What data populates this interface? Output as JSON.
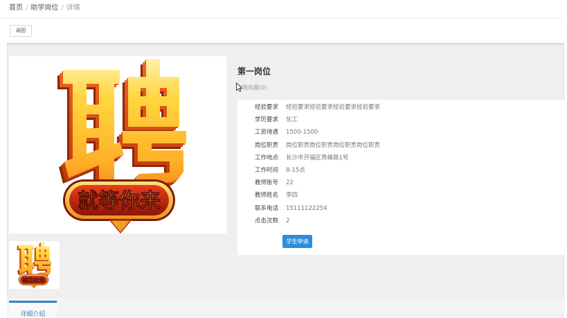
{
  "breadcrumb": {
    "home": "首页",
    "separator": "/",
    "section": "助学岗位",
    "current": "详情"
  },
  "toolbar": {
    "back_label": "返回"
  },
  "poster": {
    "headline": "聘",
    "slogan": "就等你来"
  },
  "job": {
    "title": "第一岗位",
    "favorite_label": "点我收藏(0)",
    "fields": [
      {
        "label": "经验要求",
        "value": "经验要求经验要求经验要求经验要求"
      },
      {
        "label": "学历要求",
        "value": "化工"
      },
      {
        "label": "工资待遇",
        "value": "1500-1500"
      },
      {
        "label": "岗位职责",
        "value": "岗位职责岗位职责岗位职责岗位职责"
      },
      {
        "label": "工作地点",
        "value": "长沙市开福区秀峰路1号"
      },
      {
        "label": "工作时间",
        "value": "8-15点"
      },
      {
        "label": "教师账号",
        "value": "22"
      },
      {
        "label": "教师姓名",
        "value": "李四"
      },
      {
        "label": "联系电话",
        "value": "15111122254"
      },
      {
        "label": "点击次数",
        "value": "2"
      }
    ],
    "apply_label": "学生申请"
  },
  "tabs": [
    {
      "label": "详细介绍",
      "active": true
    }
  ],
  "colors": {
    "apply_button": "#2e8ddf",
    "active_tab_border": "#2e84c6",
    "page_background": "#efefef"
  }
}
